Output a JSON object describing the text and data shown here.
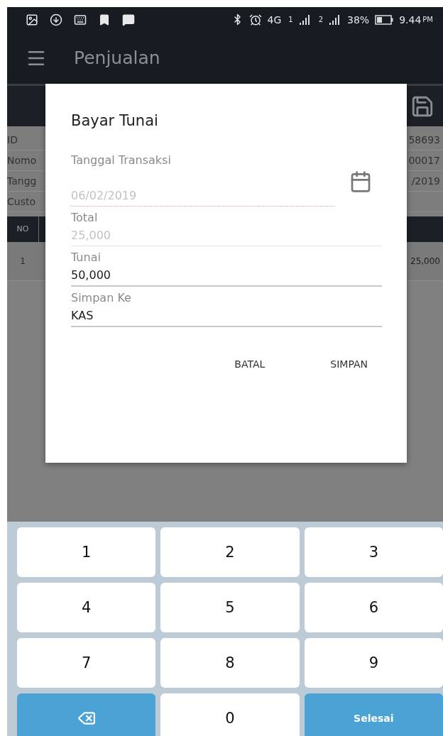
{
  "status_bar": {
    "network": "4G",
    "sim_badges": [
      "1",
      "2"
    ],
    "battery": "38%",
    "time": "9.44",
    "time_suffix": "PM"
  },
  "app_bar": {
    "title": "Penjualan"
  },
  "info_rows": [
    {
      "label": "ID",
      "value": "58693"
    },
    {
      "label": "Nomo",
      "value": "00017"
    },
    {
      "label": "Tangg",
      "value": "/2019"
    },
    {
      "label": "Custo"
    }
  ],
  "table": {
    "columns": [
      "NO"
    ],
    "rows": [
      {
        "no": "1",
        "amount": "25,000"
      }
    ]
  },
  "dialog": {
    "title": "Bayar Tunai",
    "fields": [
      {
        "kind": "date",
        "label": "Tanggal Transaksi",
        "value": "06/02/2019",
        "disabled": true
      },
      {
        "kind": "text",
        "label": "Total",
        "value": "25,000",
        "disabled": true
      },
      {
        "kind": "text",
        "label": "Tunai",
        "value": "50,000",
        "disabled": false
      },
      {
        "kind": "choice",
        "label": "Simpan Ke",
        "value": "KAS",
        "disabled": false
      }
    ],
    "buttons": [
      "BATAL",
      "SIMPAN"
    ]
  },
  "keyboard": {
    "keys": [
      {
        "kind": "digit",
        "label": "1"
      },
      {
        "kind": "digit",
        "label": "2"
      },
      {
        "kind": "digit",
        "label": "3"
      },
      {
        "kind": "digit",
        "label": "4"
      },
      {
        "kind": "digit",
        "label": "5"
      },
      {
        "kind": "digit",
        "label": "6"
      },
      {
        "kind": "digit",
        "label": "7"
      },
      {
        "kind": "digit",
        "label": "8"
      },
      {
        "kind": "digit",
        "label": "9"
      },
      {
        "kind": "backspace"
      },
      {
        "kind": "digit",
        "label": "0"
      },
      {
        "kind": "action",
        "label": "Selesai"
      }
    ]
  }
}
